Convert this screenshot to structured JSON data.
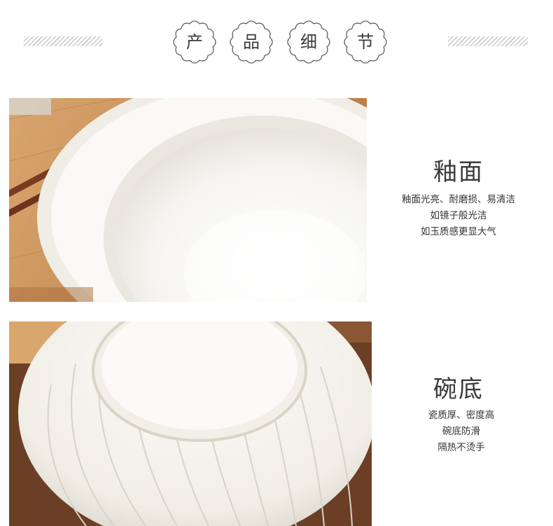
{
  "header": {
    "badges": [
      "产",
      "品",
      "细",
      "节"
    ]
  },
  "glaze": {
    "title": "釉面",
    "lines": [
      "釉面光亮、耐磨损、易清洁",
      "如镜子般光洁",
      "如玉质感更显大气"
    ]
  },
  "bottom": {
    "title": "碗底",
    "lines": [
      "瓷质厚、密度高",
      "碗底防滑",
      "隔热不烫手"
    ]
  },
  "colors": {
    "wood": "#c8905a",
    "porcelain": "#f7f6f1",
    "chopsticks": "#7a3a22",
    "dark_wood": "#6b3f25"
  }
}
